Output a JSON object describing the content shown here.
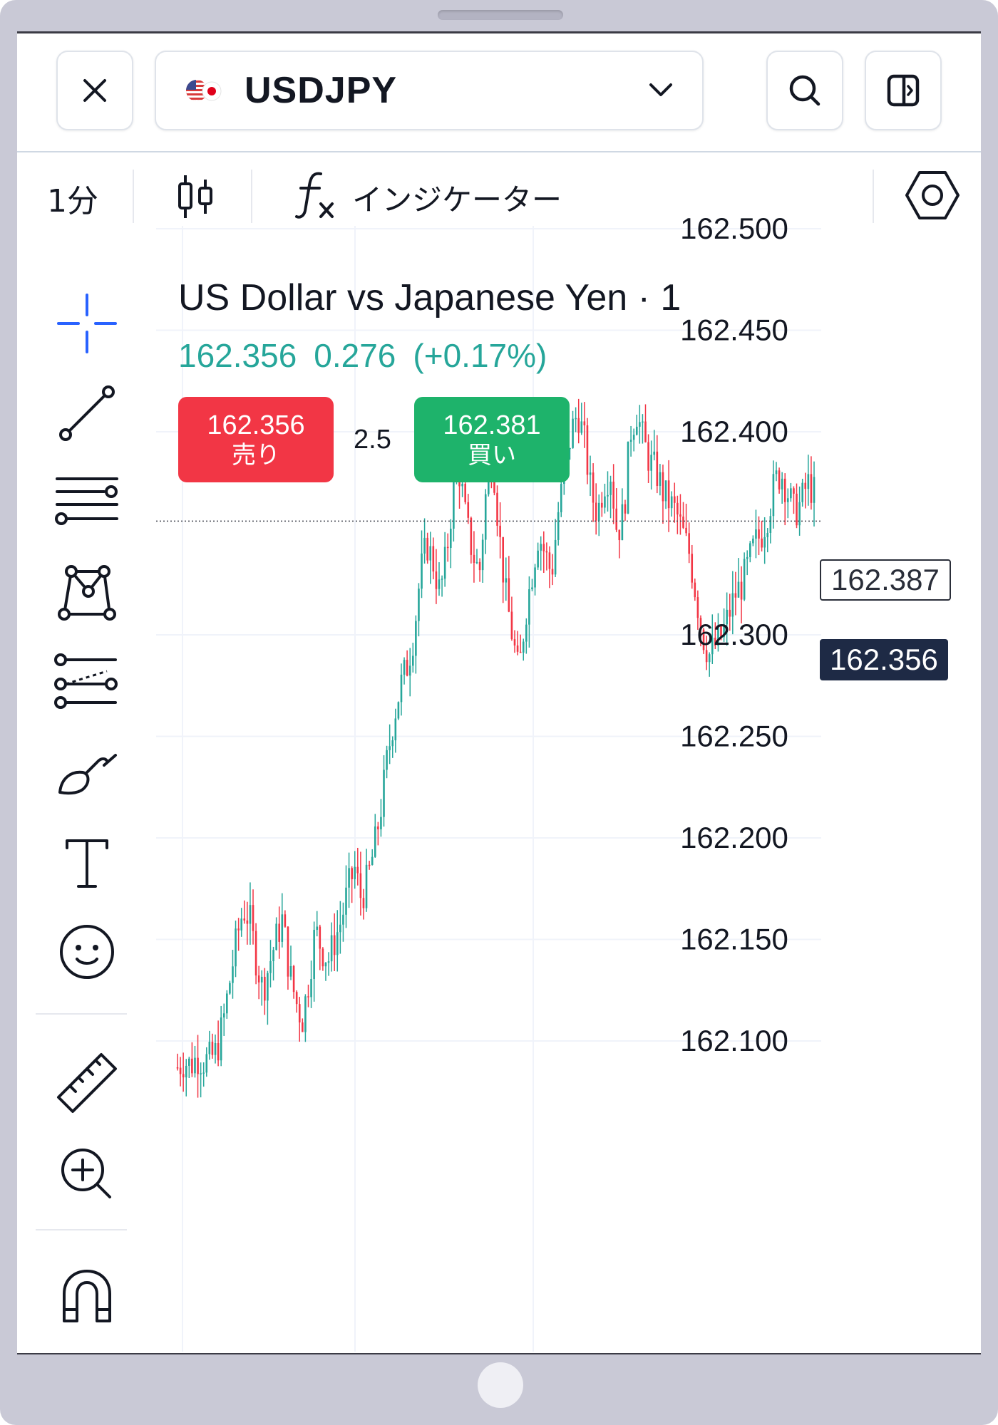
{
  "header": {
    "symbol": "USDJPY"
  },
  "toolbar": {
    "interval": "1分",
    "indicators_label": "インジケーター"
  },
  "legend": {
    "title": "US Dollar vs Japanese Yen · 1",
    "last": "162.356",
    "change": "0.276",
    "change_pct": "(+0.17%)"
  },
  "trade": {
    "sell_price": "162.356",
    "sell_label": "売り",
    "spread": "2.5",
    "buy_price": "162.381",
    "buy_label": "買い"
  },
  "price_tags": {
    "high": "162.387",
    "last": "162.356"
  },
  "colors": {
    "up": "#26a69a",
    "down": "#f23645",
    "accent": "#2962ff",
    "last_price_tag": "#1e2a45"
  },
  "left_tools": [
    "crosshair-icon",
    "trend-line-icon",
    "horizontal-lines-icon",
    "pattern-icon",
    "fib-icon",
    "brush-icon",
    "text-icon",
    "emoji-icon",
    "ruler-icon",
    "zoom-in-icon",
    "magnet-icon"
  ],
  "chart_data": {
    "type": "candlestick",
    "y_ticks": [
      "162.500",
      "162.450",
      "162.400",
      "162.300",
      "162.250",
      "162.200",
      "162.150",
      "162.100"
    ],
    "ylim": [
      162.09,
      162.51
    ],
    "last_price_line": 162.356,
    "close_path": [
      162.087,
      162.09,
      162.088,
      162.092,
      162.09,
      162.091,
      162.095,
      162.11,
      162.13,
      162.15,
      162.165,
      162.16,
      162.14,
      162.125,
      162.138,
      162.15,
      162.16,
      162.135,
      162.12,
      162.11,
      162.13,
      162.155,
      162.145,
      162.14,
      162.15,
      162.16,
      162.175,
      162.185,
      162.17,
      162.18,
      162.195,
      162.215,
      162.24,
      162.26,
      162.275,
      162.285,
      162.3,
      162.33,
      162.345,
      162.335,
      162.32,
      162.34,
      162.37,
      162.38,
      162.355,
      162.34,
      162.33,
      162.37,
      162.39,
      162.35,
      162.32,
      162.3,
      162.28,
      162.31,
      162.33,
      162.35,
      162.34,
      162.33,
      162.36,
      162.38,
      162.4,
      162.41,
      162.395,
      162.37,
      162.36,
      162.375,
      162.38,
      162.35,
      162.36,
      162.4,
      162.41,
      162.395,
      162.385,
      162.38,
      162.37,
      162.365,
      162.36,
      162.35,
      162.34,
      162.32,
      162.3,
      162.29,
      162.295,
      162.3,
      162.31,
      162.32,
      162.325,
      162.335,
      162.345,
      162.35,
      162.36,
      162.375,
      162.38,
      162.37,
      162.36,
      162.365,
      162.375,
      162.37
    ]
  }
}
